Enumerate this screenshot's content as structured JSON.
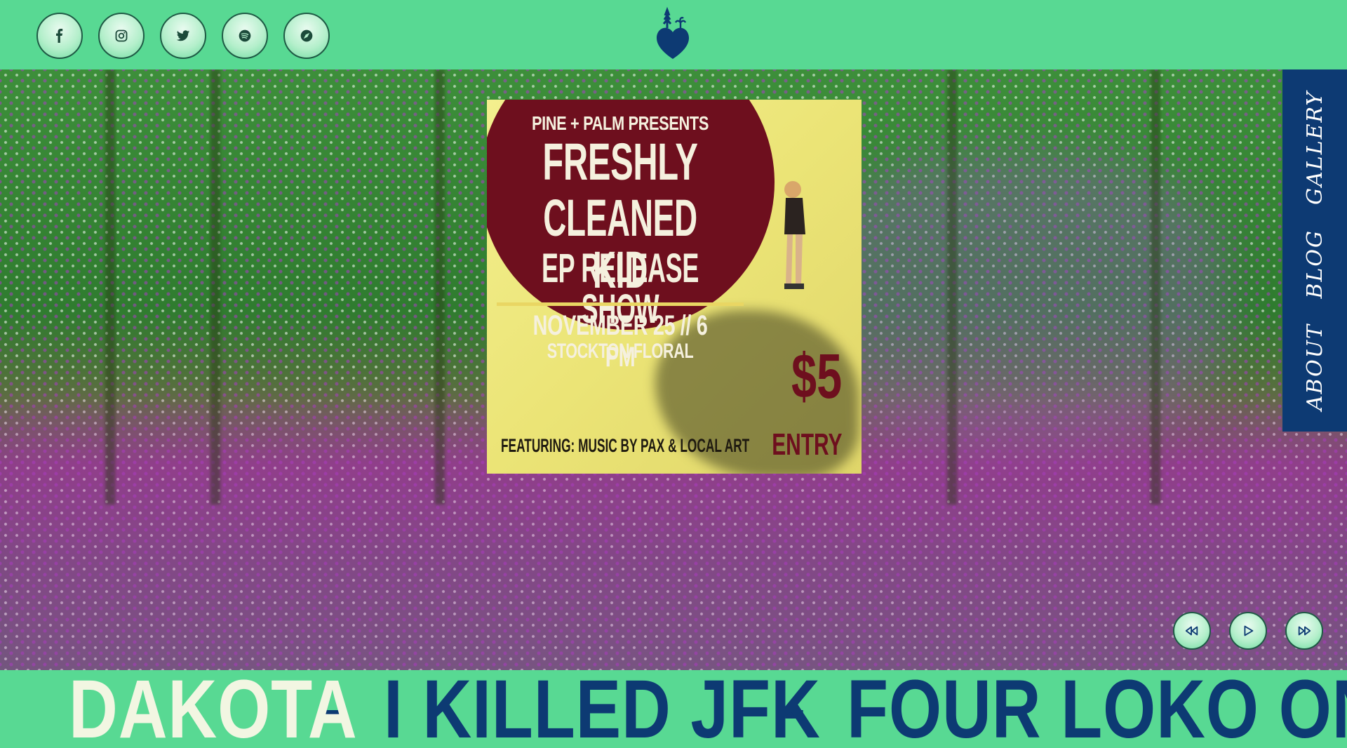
{
  "header": {
    "social": [
      {
        "icon": "facebook-icon"
      },
      {
        "icon": "instagram-icon"
      },
      {
        "icon": "twitter-icon"
      },
      {
        "icon": "spotify-icon"
      },
      {
        "icon": "compass-icon"
      }
    ],
    "logo_icon": "heart-palm-logo-icon"
  },
  "poster": {
    "presents": "PINE + PALM PRESENTS",
    "title_line1": "FRESHLY",
    "title_line2": "CLEANED KID",
    "title_line3": "EP RELEASE SHOW",
    "date": "NOVEMBER 25 // 6 PM",
    "venue": "STOCKTON FLORAL",
    "featuring": "FEATURING: MUSIC BY PAX & LOCAL ART",
    "price": "$5",
    "entry": "ENTRY",
    "colors": {
      "circle": "#6e0f1e",
      "background": "#f3ef8e"
    }
  },
  "sidenav": {
    "items": [
      {
        "label": "GALLERY"
      },
      {
        "label": "BLOG"
      },
      {
        "label": "ABOUT"
      }
    ],
    "color": "#0d3a73"
  },
  "player": {
    "controls": [
      {
        "icon": "rewind-icon"
      },
      {
        "icon": "play-icon"
      },
      {
        "icon": "fast-forward-icon"
      }
    ]
  },
  "marquee": {
    "tracks": [
      {
        "label": "DAKOTA",
        "active": true
      },
      {
        "label": "I KILLED JFK",
        "active": false
      },
      {
        "label": "FOUR LOKO ONO",
        "active": false
      }
    ],
    "separator": "-",
    "active_color": "#f2f6e2",
    "color": "#0d3a73"
  },
  "theme": {
    "accent": "#58d993",
    "navy": "#0d3a73"
  }
}
